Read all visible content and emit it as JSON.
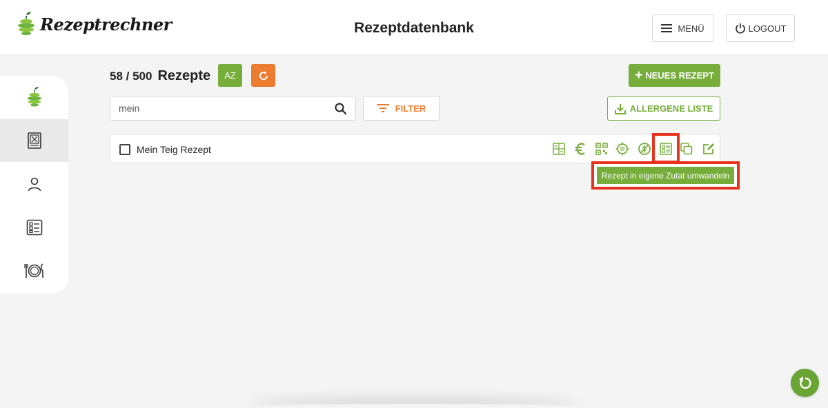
{
  "header": {
    "brand": "Rezeptrechner",
    "title": "Rezeptdatenbank",
    "menu_label": "MENÜ",
    "logout_label": "LOGOUT"
  },
  "sidebar": {
    "items": [
      {
        "icon": "apple-logo-icon",
        "active": false
      },
      {
        "icon": "recipe-book-icon",
        "active": true
      },
      {
        "icon": "user-icon",
        "active": false
      },
      {
        "icon": "checklist-icon",
        "active": false
      },
      {
        "icon": "plate-cutlery-icon",
        "active": false
      }
    ]
  },
  "recipes": {
    "count": "58 / 500",
    "label": "Rezepte",
    "sort_label": "AZ",
    "new_label": "NEUES REZEPT",
    "allergen_label": "ALLERGENE LISTE",
    "filter_label": "FILTER",
    "search_value": "mein",
    "items": [
      {
        "name": "Mein Teig Rezept"
      }
    ]
  },
  "tooltip": {
    "text": "Rezept in eigene Zutat umwandeln"
  },
  "colors": {
    "green": "#76ad3b",
    "orange": "#ec7c30",
    "highlight_red": "#e8321e"
  }
}
